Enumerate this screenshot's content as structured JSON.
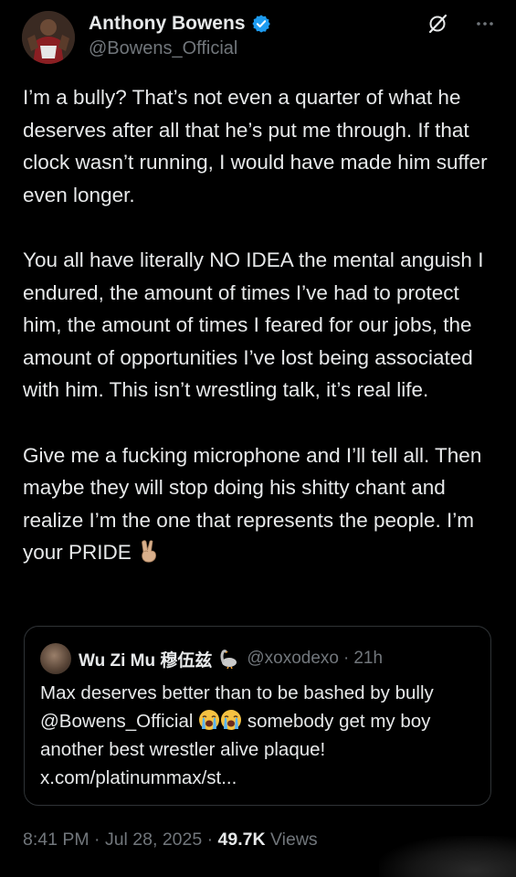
{
  "tweet": {
    "author": {
      "display_name": "Anthony Bowens",
      "handle": "@Bowens_Official",
      "verified": true,
      "verified_color": "#1d9bf0"
    },
    "paragraphs": [
      "I’m a bully? That’s not even a quarter of what he deserves after all that he’s put me through. If that clock wasn’t running, I would have made him suffer even longer.",
      "You all have literally NO IDEA the mental anguish I endured, the amount of times I’ve had to protect him, the amount of times I feared for our jobs, the amount of opportunities I’ve lost being associated with him. This isn’t wrestling talk, it’s real life.",
      "Give me a fucking microphone and I’ll tell all. Then maybe they will stop doing his shitty chant and realize I’m the one that represents the people. I’m your PRIDE"
    ],
    "trailing_emoji": "victory-hand-emoji",
    "quoted": {
      "display_name": "Wu Zi Mu 穆伍兹",
      "name_emoji": "goose-emoji",
      "handle": "@xoxodexo",
      "separator": "·",
      "time": "21h",
      "text_part1": "Max deserves better than to be bashed by bully @Bowens_Official",
      "text_emoji": "loudly-crying-face-emoji",
      "text_part2": "somebody get my boy another best wrestler alive plaque!",
      "link": "x.com/platinummax/st..."
    },
    "timestamp": "8:41 PM · Jul 28, 2025",
    "meta_separator": "·",
    "views_count": "49.7K",
    "views_label": "Views"
  },
  "colors": {
    "background": "#000000",
    "text_primary": "#e7e9ea",
    "text_secondary": "#71767b",
    "border": "#2f3336",
    "accent": "#1d9bf0"
  }
}
